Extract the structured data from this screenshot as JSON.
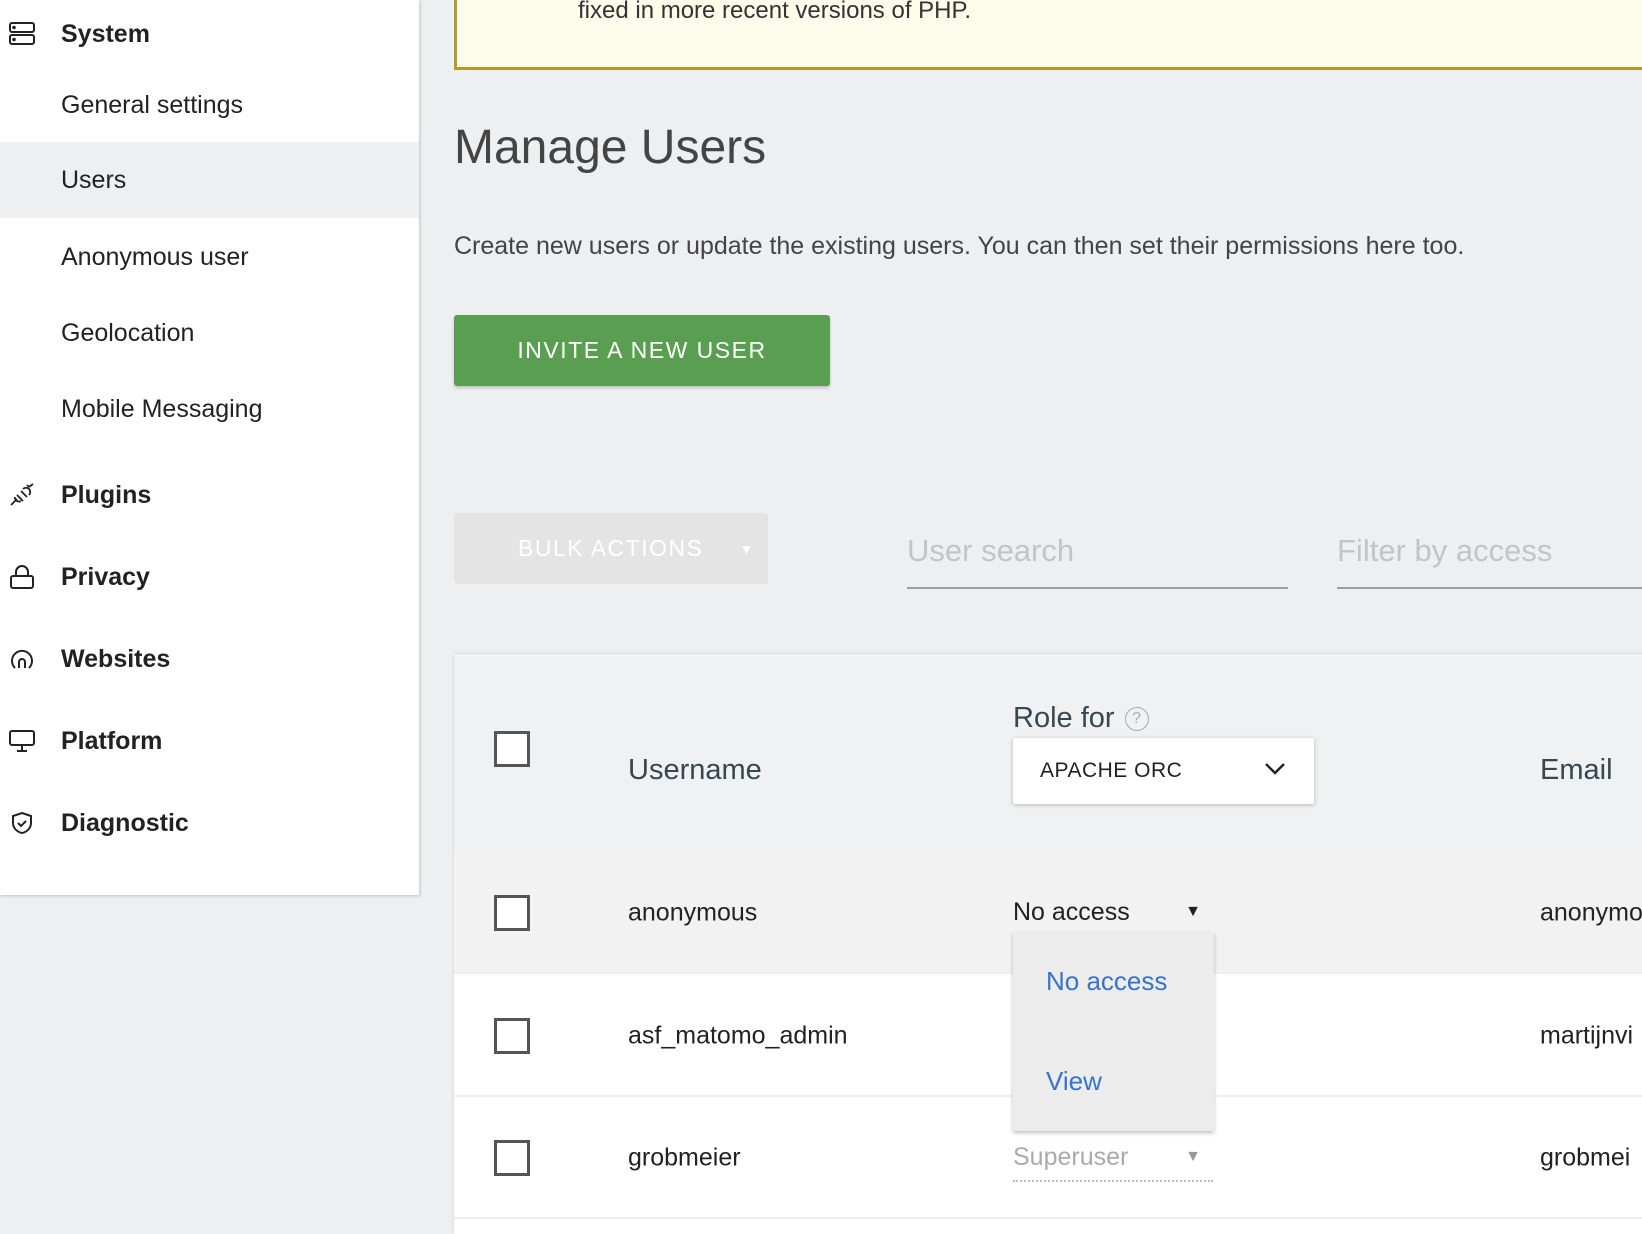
{
  "warning": {
    "text": "fixed in more recent versions of PHP."
  },
  "sidebar": {
    "system": {
      "label": "System",
      "icon": "server-icon"
    },
    "system_items": [
      {
        "label": "General settings"
      },
      {
        "label": "Users",
        "active": true
      },
      {
        "label": "Anonymous user"
      },
      {
        "label": "Geolocation"
      },
      {
        "label": "Mobile Messaging"
      }
    ],
    "sections": [
      {
        "label": "Plugins",
        "icon": "plug-icon"
      },
      {
        "label": "Privacy",
        "icon": "lock-icon"
      },
      {
        "label": "Websites",
        "icon": "location-icon"
      },
      {
        "label": "Platform",
        "icon": "monitor-icon"
      },
      {
        "label": "Diagnostic",
        "icon": "shield-check-icon"
      }
    ]
  },
  "main": {
    "title": "Manage Users",
    "description": "Create new users or update the existing users. You can then set their permissions here too.",
    "invite_label": "INVITE A NEW USER",
    "bulk_label": "BULK ACTIONS",
    "search_placeholder": "User search",
    "filter_placeholder": "Filter by access"
  },
  "table": {
    "headers": {
      "username": "Username",
      "role_for": "Role for",
      "email": "Email"
    },
    "site_select": "APACHE ORC",
    "rows": [
      {
        "username": "anonymous",
        "role": "No access",
        "email": "anonymo"
      },
      {
        "username": "asf_matomo_admin",
        "role": "",
        "email": "martijnvi"
      },
      {
        "username": "grobmeier",
        "role": "Superuser",
        "email": "grobmei"
      }
    ],
    "role_menu": [
      "No access",
      "View"
    ]
  },
  "colors": {
    "accent": "#5a9f51",
    "link": "#3674cc",
    "warning_border": "#b29a2e"
  }
}
